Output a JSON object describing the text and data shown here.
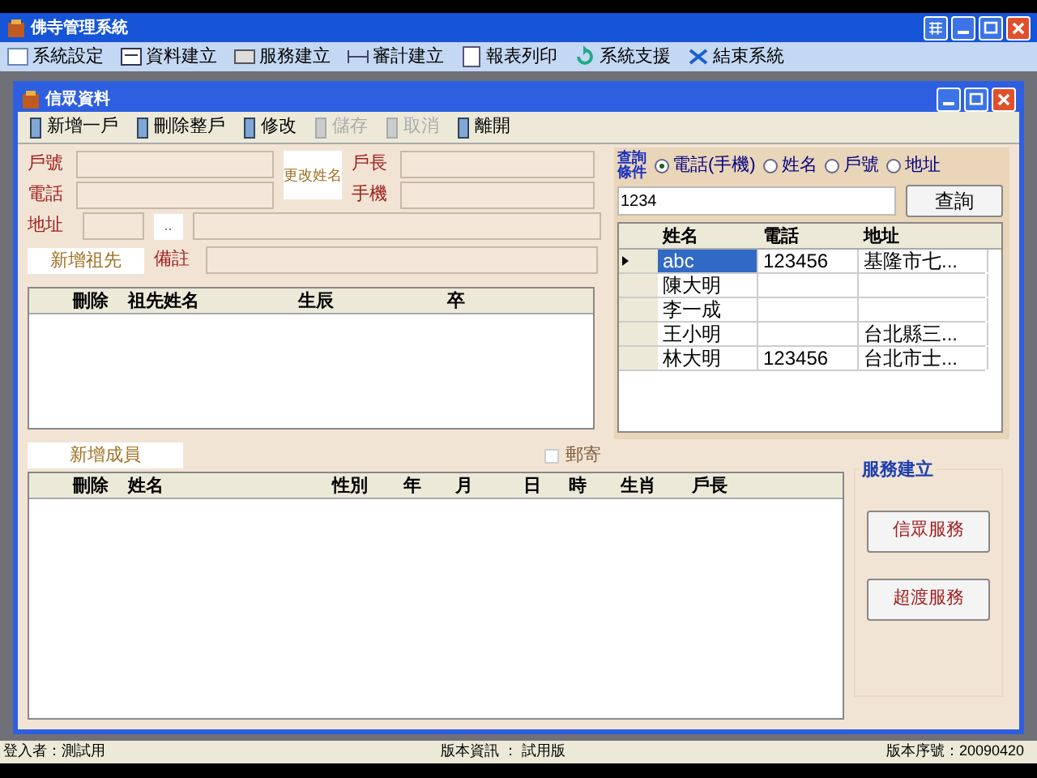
{
  "window": {
    "title": "佛寺管理系統"
  },
  "menu": [
    {
      "label": "系統設定"
    },
    {
      "label": "資料建立"
    },
    {
      "label": "服務建立"
    },
    {
      "label": "審計建立"
    },
    {
      "label": "報表列印"
    },
    {
      "label": "系統支援"
    },
    {
      "label": "結束系統"
    }
  ],
  "child_window": {
    "title": "信眾資料"
  },
  "toolbar": [
    {
      "label": "新增一戶",
      "disabled": false
    },
    {
      "label": "刪除整戶",
      "disabled": false
    },
    {
      "label": "修改",
      "disabled": false
    },
    {
      "label": "儲存",
      "disabled": true
    },
    {
      "label": "取消",
      "disabled": true
    },
    {
      "label": "離開",
      "disabled": false
    }
  ],
  "household": {
    "household_no_label": "戶號",
    "phone_label": "電話",
    "address_label": "地址",
    "rename_button": "更改姓名",
    "head_label": "戶長",
    "mobile_label": "手機",
    "browse_button": "..",
    "add_ancestor_button": "新增祖先",
    "note_label": "備註"
  },
  "ancestors_table": {
    "columns": [
      "刪除",
      "祖先姓名",
      "生辰",
      "卒"
    ]
  },
  "search": {
    "label": "查詢條件",
    "options": [
      {
        "label": "電話(手機)",
        "selected": true
      },
      {
        "label": "姓名",
        "selected": false
      },
      {
        "label": "戶號",
        "selected": false
      },
      {
        "label": "地址",
        "selected": false
      }
    ],
    "query": "1234",
    "button": "查詢",
    "columns": [
      "姓名",
      "電話",
      "地址"
    ],
    "rows": [
      {
        "cells": [
          "abc",
          "123456",
          "基隆市七..."
        ],
        "selected": true
      },
      {
        "cells": [
          "陳大明",
          "",
          ""
        ],
        "selected": false
      },
      {
        "cells": [
          "李一成",
          "",
          ""
        ],
        "selected": false
      },
      {
        "cells": [
          "王小明",
          "",
          "台北縣三..."
        ],
        "selected": false
      },
      {
        "cells": [
          "林大明",
          "123456",
          "台北市士..."
        ],
        "selected": false
      }
    ]
  },
  "members": {
    "add_member_button": "新增成員",
    "mail_checkbox": {
      "label": "郵寄",
      "checked": false
    },
    "columns": [
      "刪除",
      "姓名",
      "性別",
      "年",
      "月",
      "日",
      "時",
      "生肖",
      "戶長"
    ]
  },
  "services": {
    "title": "服務建立",
    "buttons": [
      "信眾服務",
      "超渡服務"
    ]
  },
  "status_bar": {
    "user": "登入者：測試用",
    "version_info": "版本資訊 ： 試用版",
    "version_no": "版本序號：20090420"
  }
}
